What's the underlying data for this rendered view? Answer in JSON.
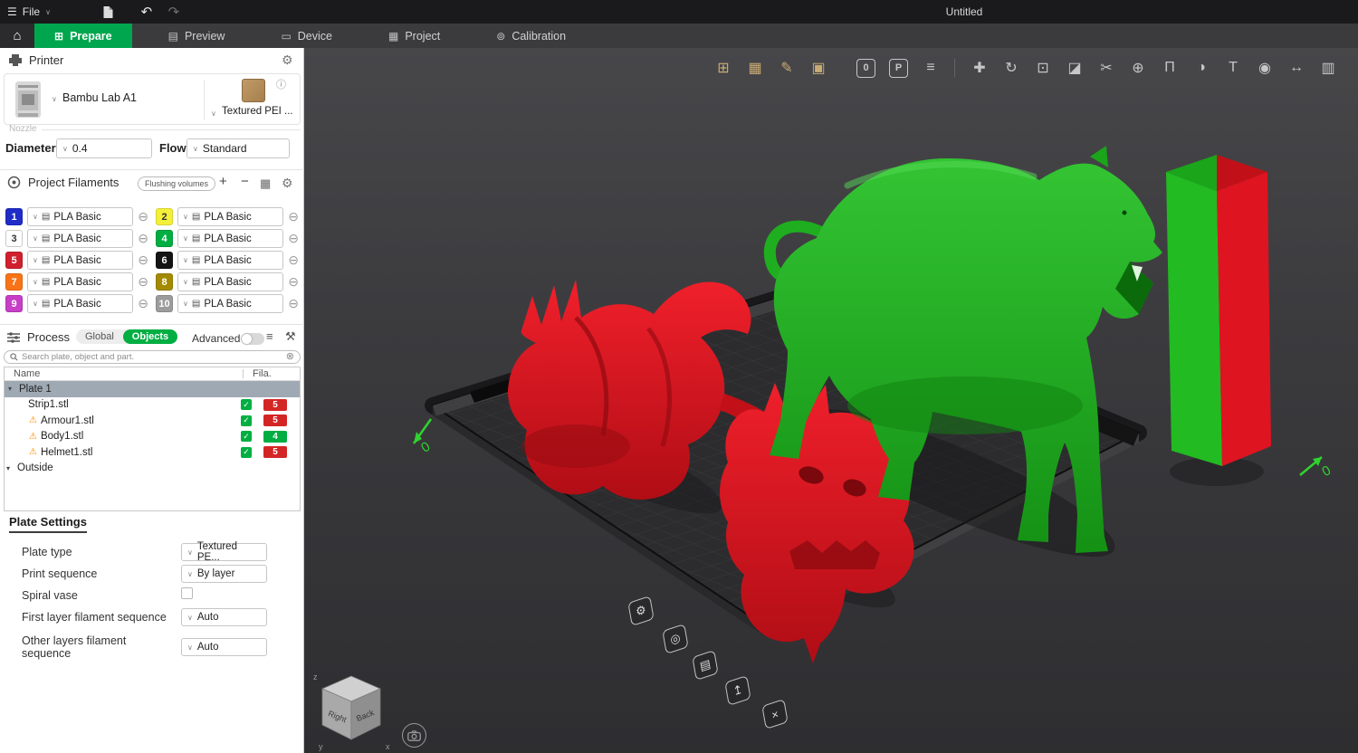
{
  "icons": {
    "hamburger": "☰",
    "chevron": "∨",
    "tree_chevron": "▾",
    "home": "⌂",
    "undo": "↶",
    "redo": "↷",
    "gear": "⚙",
    "info": "ⓘ",
    "minus_circle": "⊖",
    "plus": "+",
    "minus": "−",
    "ams_grid": "▦",
    "list": "≡",
    "tune": "⚒",
    "check": "✓",
    "warning": "⚠",
    "clear": "⊗",
    "filament_chip": "▤"
  },
  "titlebar": {
    "menu_label": "File",
    "doc_title": "Untitled"
  },
  "tabs": {
    "items": [
      {
        "glyph": "⊞",
        "label": "Prepare"
      },
      {
        "glyph": "▤",
        "label": "Preview"
      },
      {
        "glyph": "▭",
        "label": "Device"
      },
      {
        "glyph": "▦",
        "label": "Project"
      },
      {
        "glyph": "⊚",
        "label": "Calibration"
      }
    ]
  },
  "printer": {
    "section_title": "Printer",
    "name": "Bambu Lab A1",
    "plate_type": "Textured PEI ...",
    "nozzle_label": "Nozzle",
    "diameter_label": "Diameter",
    "diameter_value": "0.4",
    "flow_label": "Flow",
    "flow_value": "Standard"
  },
  "filaments": {
    "section_title": "Project Filaments",
    "flushing_button": "Flushing volumes",
    "items": [
      {
        "num": "1",
        "material": "PLA Basic",
        "style": "background:#1f2cc8;color:#fff"
      },
      {
        "num": "2",
        "material": "PLA Basic",
        "style": "background:#f4ef39;color:#333"
      },
      {
        "num": "3",
        "material": "PLA Basic",
        "style": "background:#ffffff;color:#333;border:1px solid #c9c9c9"
      },
      {
        "num": "4",
        "material": "PLA Basic",
        "style": "background:#00ae42;color:#fff"
      },
      {
        "num": "5",
        "material": "PLA Basic",
        "style": "background:#d01f2e;color:#fff"
      },
      {
        "num": "6",
        "material": "PLA Basic",
        "style": "background:#141414;color:#fff"
      },
      {
        "num": "7",
        "material": "PLA Basic",
        "style": "background:#f97316;color:#fff"
      },
      {
        "num": "8",
        "material": "PLA Basic",
        "style": "background:#a38a00;color:#fff"
      },
      {
        "num": "9",
        "material": "PLA Basic",
        "style": "background:#c73ec7;color:#fff"
      },
      {
        "num": "10",
        "material": "PLA Basic",
        "style": "background:#9c9c9c;color:#fff"
      }
    ]
  },
  "process": {
    "section_title": "Process",
    "seg_global": "Global",
    "seg_objects": "Objects",
    "advanced_label": "Advanced",
    "search_placeholder": "Search plate, object and part."
  },
  "tree": {
    "col_name": "Name",
    "col_fila": "Fila.",
    "rows": [
      {
        "label": "Plate 1"
      },
      {
        "label": "Strip1.stl",
        "fila": "5",
        "badge_style": "background:#d42525"
      },
      {
        "label": "Armour1.stl",
        "fila": "5",
        "badge_style": "background:#d42525"
      },
      {
        "label": "Body1.stl",
        "fila": "4",
        "badge_style": "background:#00ae42"
      },
      {
        "label": "Helmet1.stl",
        "fila": "5",
        "badge_style": "background:#d42525"
      },
      {
        "label": "Outside"
      }
    ]
  },
  "plate_settings": {
    "title": "Plate Settings",
    "rows": [
      {
        "label": "Plate type",
        "value": "Textured PE..."
      },
      {
        "label": "Print sequence",
        "value": "By layer"
      },
      {
        "label": "Spiral vase",
        "value": ""
      },
      {
        "label": "First layer filament sequence",
        "value": "Auto"
      },
      {
        "label": "Other layers filament sequence",
        "value": "Auto"
      }
    ]
  },
  "viewport": {
    "toolbar": [
      {
        "name": "add-object-icon",
        "glyph": "⊞"
      },
      {
        "name": "add-plate-icon",
        "glyph": "▦"
      },
      {
        "name": "auto-orient-icon",
        "glyph": "✎"
      },
      {
        "name": "arrange-icon",
        "glyph": "▣"
      },
      {
        "name": "fill-color-icon",
        "glyph": "0"
      },
      {
        "name": "filament-group-icon",
        "glyph": "P"
      },
      {
        "name": "objects-list-icon",
        "glyph": "≡"
      },
      {
        "name": "move-icon",
        "glyph": "✚"
      },
      {
        "name": "rotate-icon",
        "glyph": "↻"
      },
      {
        "name": "scale-icon",
        "glyph": "⊡"
      },
      {
        "name": "lay-flat-icon",
        "glyph": "◪"
      },
      {
        "name": "cut-icon",
        "glyph": "✂"
      },
      {
        "name": "mesh-boolean-icon",
        "glyph": "⊕"
      },
      {
        "name": "support-paint-icon",
        "glyph": "Π"
      },
      {
        "name": "color-paint-icon",
        "glyph": "◑"
      },
      {
        "name": "text-icon",
        "glyph": "T"
      },
      {
        "name": "seam-paint-icon",
        "glyph": "◉"
      },
      {
        "name": "measure-icon",
        "glyph": "↔"
      },
      {
        "name": "assembly-icon",
        "glyph": "▥"
      }
    ],
    "plate_buttons": [
      {
        "name": "plate-settings-icon",
        "glyph": "⚙"
      },
      {
        "name": "plate-filament-icon",
        "glyph": "◎"
      },
      {
        "name": "plate-lock-icon",
        "glyph": "▤"
      },
      {
        "name": "plate-export-icon",
        "glyph": "↥"
      },
      {
        "name": "plate-delete-icon",
        "glyph": "×"
      }
    ],
    "navcube": {
      "left_face": "Right",
      "right_face": "Back",
      "axis_z": "z",
      "axis_y": "y",
      "axis_x": "x"
    },
    "axis_zero": "0"
  },
  "scene": {
    "colors": {
      "plate": "#2c2c2e",
      "grid_line": "#3d3d3f",
      "model_green": "#1db31d",
      "model_red": "#e01320",
      "tower_green": "#22bb22",
      "tower_red": "#de1420",
      "tower_top_green": "#1aa51a",
      "tower_top_red": "#c11018",
      "accent_green": "#2fd32f"
    }
  }
}
